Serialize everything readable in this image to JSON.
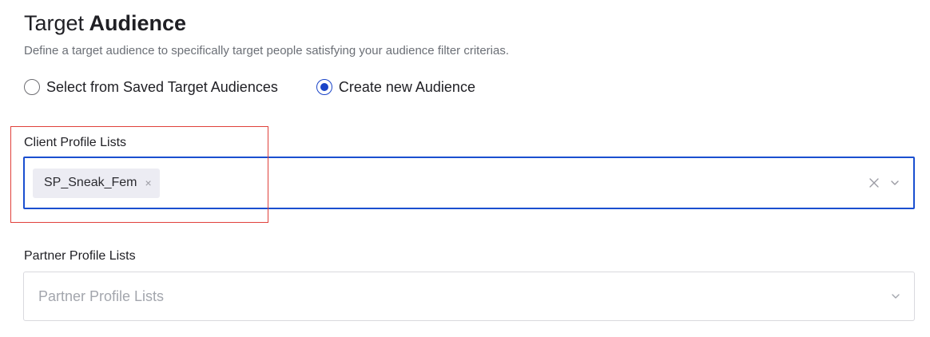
{
  "header": {
    "title_light": "Target",
    "title_bold": "Audience",
    "subtitle": "Define a target audience to specifically target people satisfying your audience filter criterias."
  },
  "audience_mode": {
    "options": [
      {
        "label": "Select from Saved Target Audiences",
        "checked": false
      },
      {
        "label": "Create new Audience",
        "checked": true
      }
    ]
  },
  "client_profile_lists": {
    "label": "Client Profile Lists",
    "selected_tags": [
      "SP_Sneak_Fem"
    ],
    "tag_remove_glyph": "×",
    "clear_icon": "clear-icon",
    "dropdown_icon": "chevron-down-icon"
  },
  "partner_profile_lists": {
    "label": "Partner Profile Lists",
    "placeholder": "Partner Profile Lists",
    "dropdown_icon": "chevron-down-icon"
  },
  "colors": {
    "accent": "#1a44c8",
    "focus_border": "#1a4fd0",
    "highlight": "#e0413b",
    "tag_bg": "#ececf3",
    "muted_text": "#6b6f76",
    "placeholder_text": "#a3a6ad"
  }
}
